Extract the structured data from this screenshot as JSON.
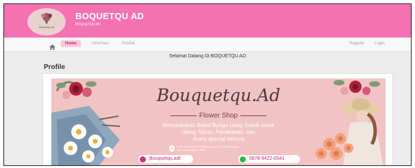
{
  "header": {
    "brand_title": "BOQUETQU AD",
    "brand_subtitle": "BOQUETQU AD",
    "logo_text": "Bouquetqu.ad",
    "background_color": "#f472b1"
  },
  "nav": {
    "home_icon": "home-icon",
    "items": [
      {
        "label": "Home"
      },
      {
        "label": "Informasi"
      },
      {
        "label": "Produk"
      }
    ],
    "register": "Register",
    "login": "Login"
  },
  "welcome": "Selamat Datang Di BOQUETQU AD",
  "profile_title": "Profile",
  "banner": {
    "script_title": "Bouquetqu.Ad",
    "shop_label": "Flower Shop",
    "description_line1": "Menyediakan Buket Bunga Uang Snack untuk",
    "description_line2": "Ulang Tahun, Pernikahan, dan",
    "description_line3": "Acara special lainnya",
    "address_line1": "Jl. MTI Suprehman, Kampung Lalah, Kec. Mruna Bengkle",
    "address_line2": "Tulis, Kota Bengkulu, 3829",
    "instagram": "Bouquetqu.adt",
    "whatsapp": "0878-9422-0541",
    "background_color": "#f2c3c3"
  }
}
